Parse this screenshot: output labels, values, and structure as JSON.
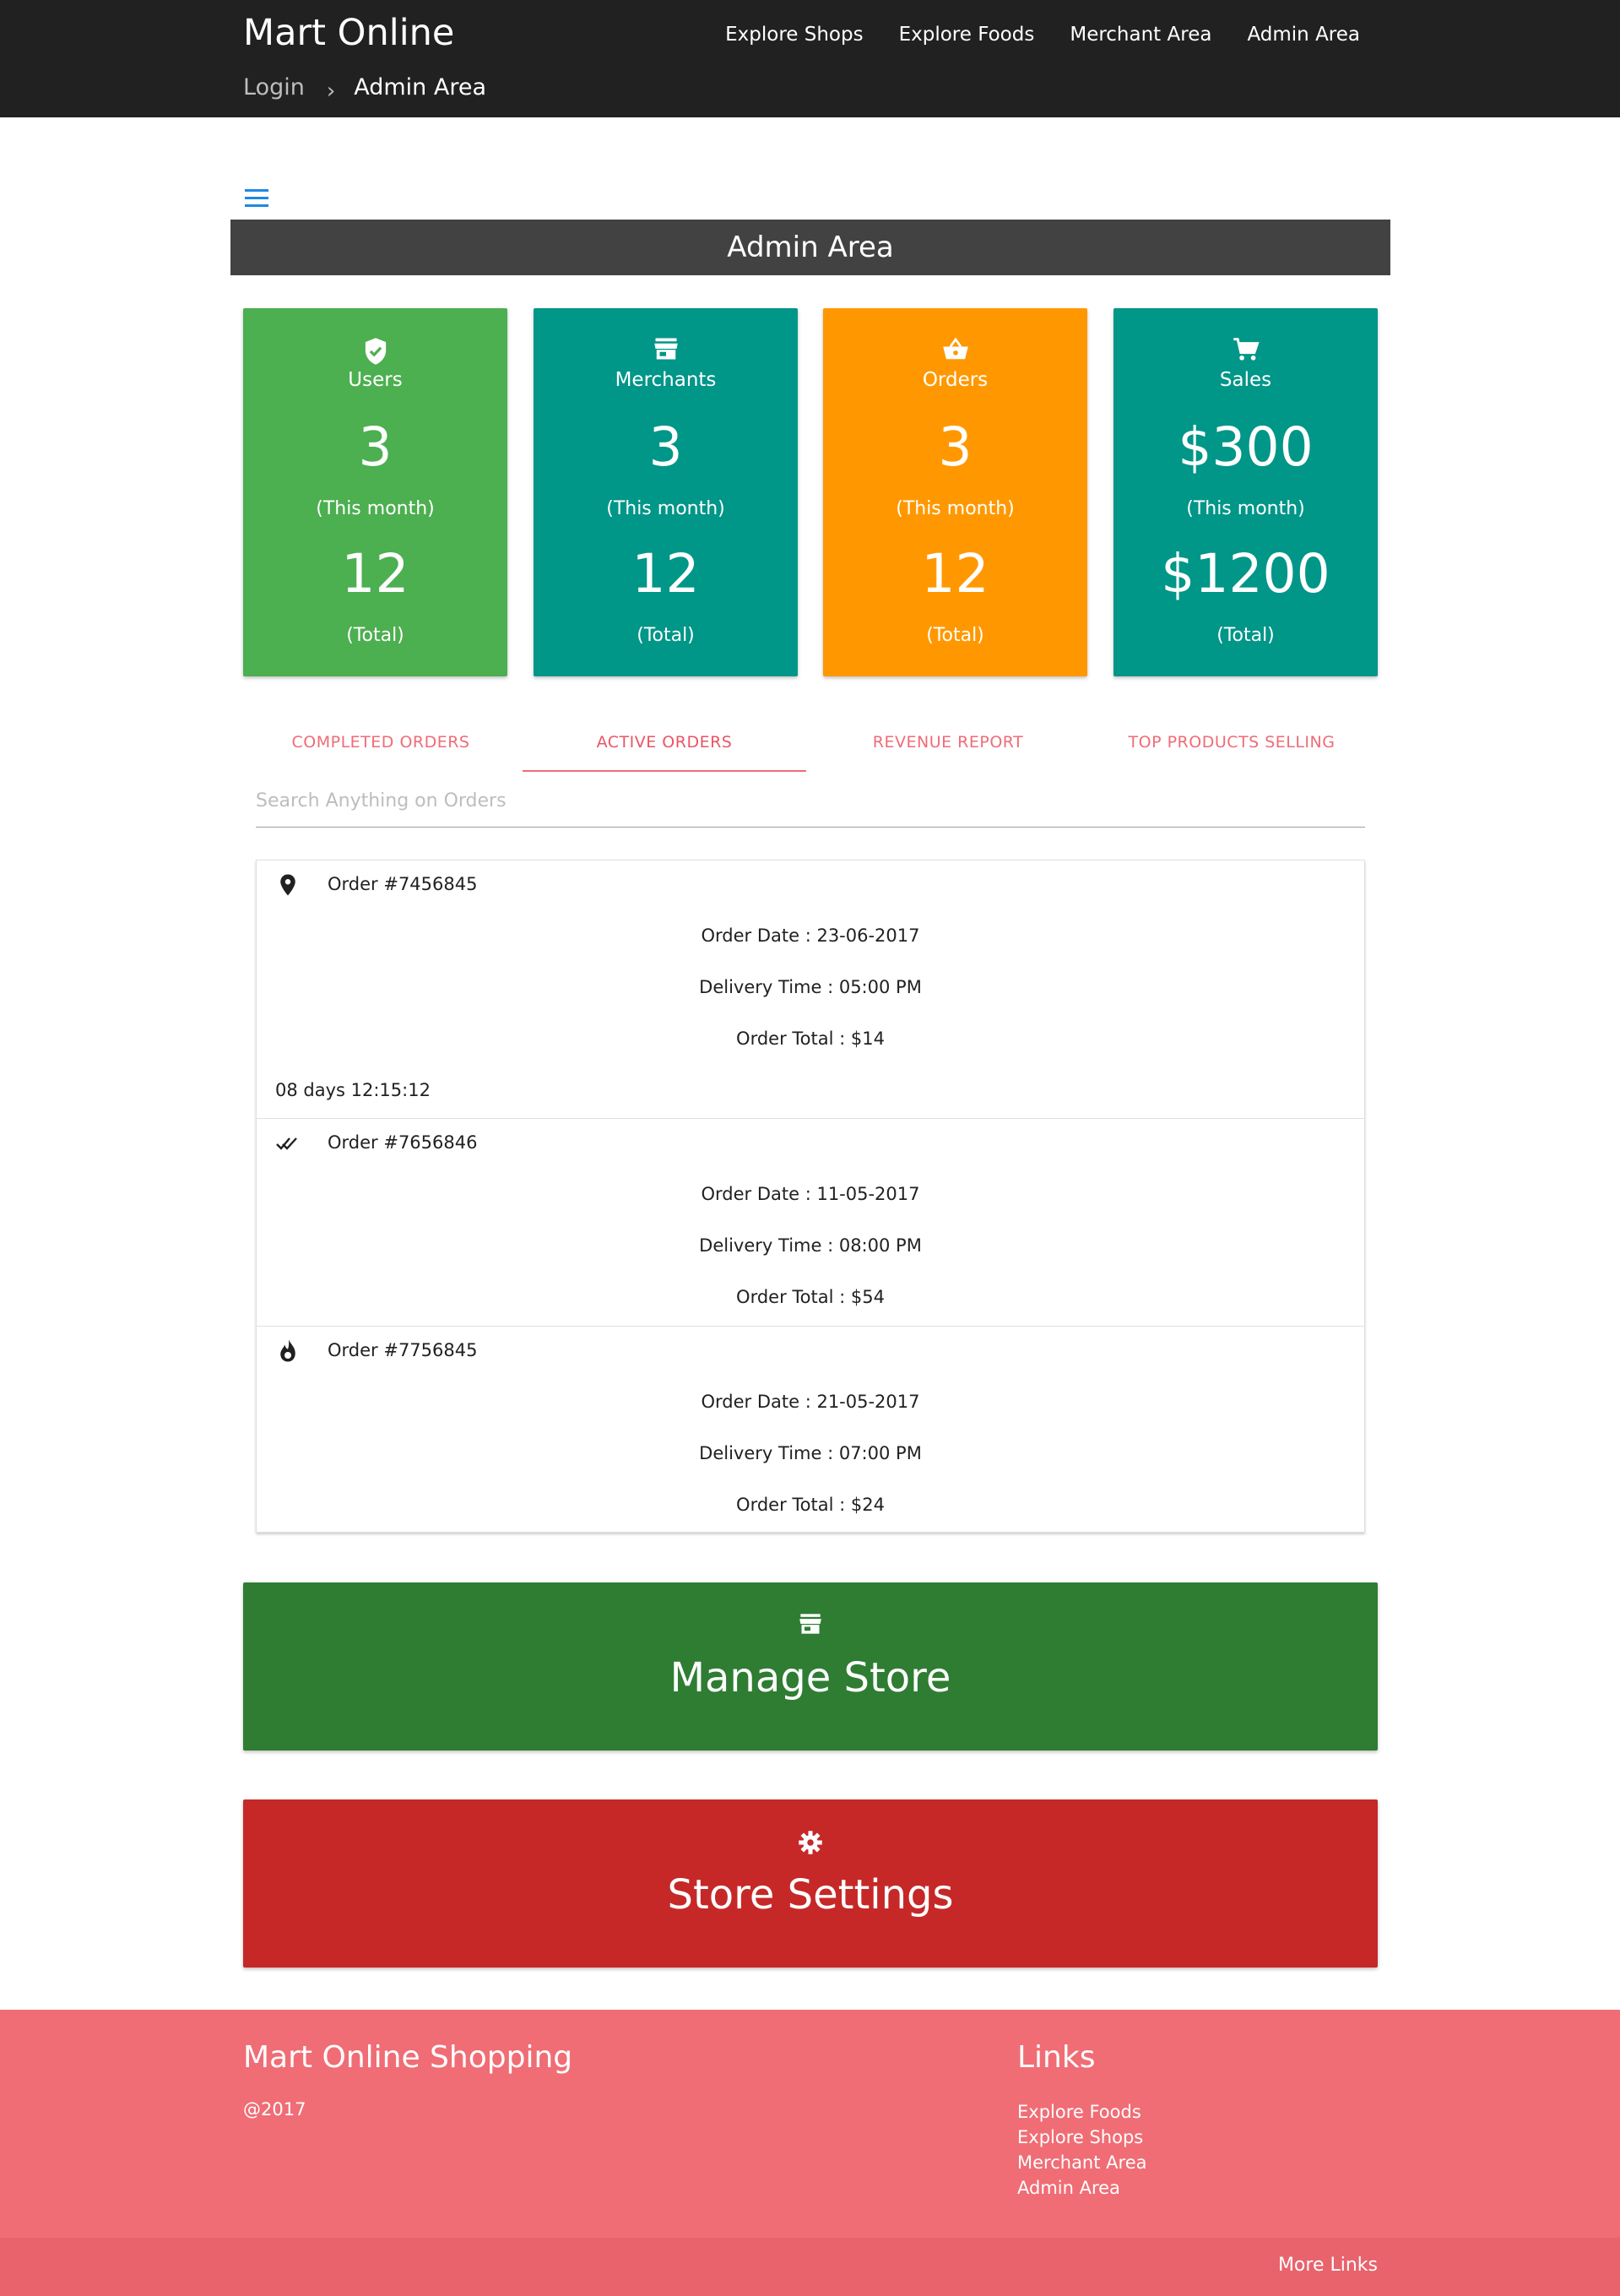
{
  "header": {
    "brand": "Mart Online",
    "nav": [
      "Explore Shops",
      "Explore Foods",
      "Merchant Area",
      "Admin Area"
    ],
    "breadcrumb": {
      "first": "Login",
      "separator": "›",
      "current": "Admin Area"
    }
  },
  "banner": {
    "title": "Admin Area"
  },
  "stats": [
    {
      "label": "Users",
      "icon": "shield-check-icon",
      "month": "3",
      "month_caption": "(This month)",
      "total": "12",
      "total_caption": "(Total)",
      "color": "#4caf50"
    },
    {
      "label": "Merchants",
      "icon": "store-icon",
      "month": "3",
      "month_caption": "(This month)",
      "total": "12",
      "total_caption": "(Total)",
      "color": "#009688"
    },
    {
      "label": "Orders",
      "icon": "basket-icon",
      "month": "3",
      "month_caption": "(This month)",
      "total": "12",
      "total_caption": "(Total)",
      "color": "#ff9800"
    },
    {
      "label": "Sales",
      "icon": "cart-icon",
      "month": "$300",
      "month_caption": "(This month)",
      "total": "$1200",
      "total_caption": "(Total)",
      "color": "#009688"
    }
  ],
  "tabs": [
    "COMPLETED ORDERS",
    "ACTIVE ORDERS",
    "REVENUE REPORT",
    "TOP PRODUCTS SELLING"
  ],
  "active_tab": "ACTIVE ORDERS",
  "search": {
    "placeholder": "Search Anything on Orders"
  },
  "orders": [
    {
      "icon": "location-pin-icon",
      "id": "Order #7456845",
      "date": "Order Date : 23-06-2017",
      "delivery": "Delivery Time : 05:00 PM",
      "total": "Order Total : $14",
      "timer": "08 days 12:15:12"
    },
    {
      "icon": "double-check-icon",
      "id": "Order #7656846",
      "date": "Order Date : 11-05-2017",
      "delivery": "Delivery Time : 08:00 PM",
      "total": "Order Total : $54"
    },
    {
      "icon": "flame-icon",
      "id": "Order #7756845",
      "date": "Order Date : 21-05-2017",
      "delivery": "Delivery Time : 07:00 PM",
      "total": "Order Total : $24"
    }
  ],
  "actions": {
    "manage_store": {
      "label": "Manage Store",
      "icon": "store-icon",
      "color": "#2e7d32"
    },
    "store_settings": {
      "label": "Store Settings",
      "icon": "gear-icon",
      "color": "#c62828"
    }
  },
  "footer": {
    "title": "Mart Online Shopping",
    "copyright": "@2017",
    "links_title": "Links",
    "links": [
      "Explore Foods",
      "Explore Shops",
      "Merchant Area",
      "Admin Area"
    ],
    "more_links": "More Links"
  },
  "colors": {
    "header": "#212121",
    "banner": "#424242",
    "accent": "#f06b78",
    "footer": "#f06d75",
    "subfooter": "#e8636c"
  }
}
